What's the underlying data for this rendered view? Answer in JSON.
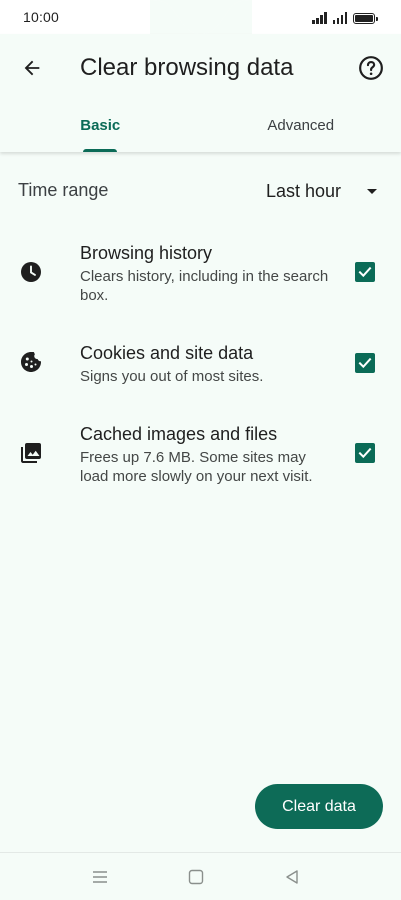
{
  "status_bar": {
    "time": "10:00",
    "icons": [
      "signal-icon",
      "signal-icon",
      "battery-icon"
    ]
  },
  "header": {
    "title": "Clear browsing data",
    "back_icon": "arrow-back-icon",
    "help_icon": "help-circle-icon"
  },
  "tabs": [
    {
      "label": "Basic",
      "active": true
    },
    {
      "label": "Advanced",
      "active": false
    }
  ],
  "time_range": {
    "label": "Time range",
    "value": "Last hour"
  },
  "options": [
    {
      "title": "Browsing history",
      "description": "Clears history, including in the search box.",
      "icon": "clock-icon",
      "checked": true
    },
    {
      "title": "Cookies and site data",
      "description": "Signs you out of most sites.",
      "icon": "cookie-icon",
      "checked": true
    },
    {
      "title": "Cached images and files",
      "description": "Frees up 7.6 MB. Some sites may load more slowly on your next visit.",
      "icon": "image-stack-icon",
      "checked": true
    }
  ],
  "primary_action": {
    "label": "Clear data"
  },
  "colors": {
    "accent": "#0b6b57",
    "background": "#f5fcf8",
    "text_primary": "#1f1f1f",
    "text_secondary": "#444746"
  },
  "nav_bar": {
    "icons": [
      "menu-icon",
      "home-square-icon",
      "back-triangle-icon"
    ]
  }
}
